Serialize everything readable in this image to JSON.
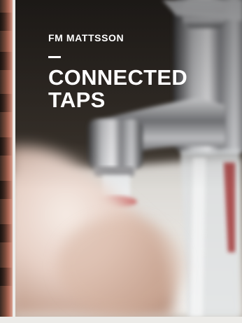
{
  "card": {
    "brand": "FM MATTSSON",
    "title_line1": "CONNECTED",
    "title_line2": "TAPS",
    "image": "faucet-with-hand-photo"
  },
  "side_card": {
    "image": "partial-adjacent-card-photo"
  },
  "colors": {
    "text": "#ffffff",
    "page_background": "#ecebe8",
    "photo_dark": "#2a2724"
  }
}
